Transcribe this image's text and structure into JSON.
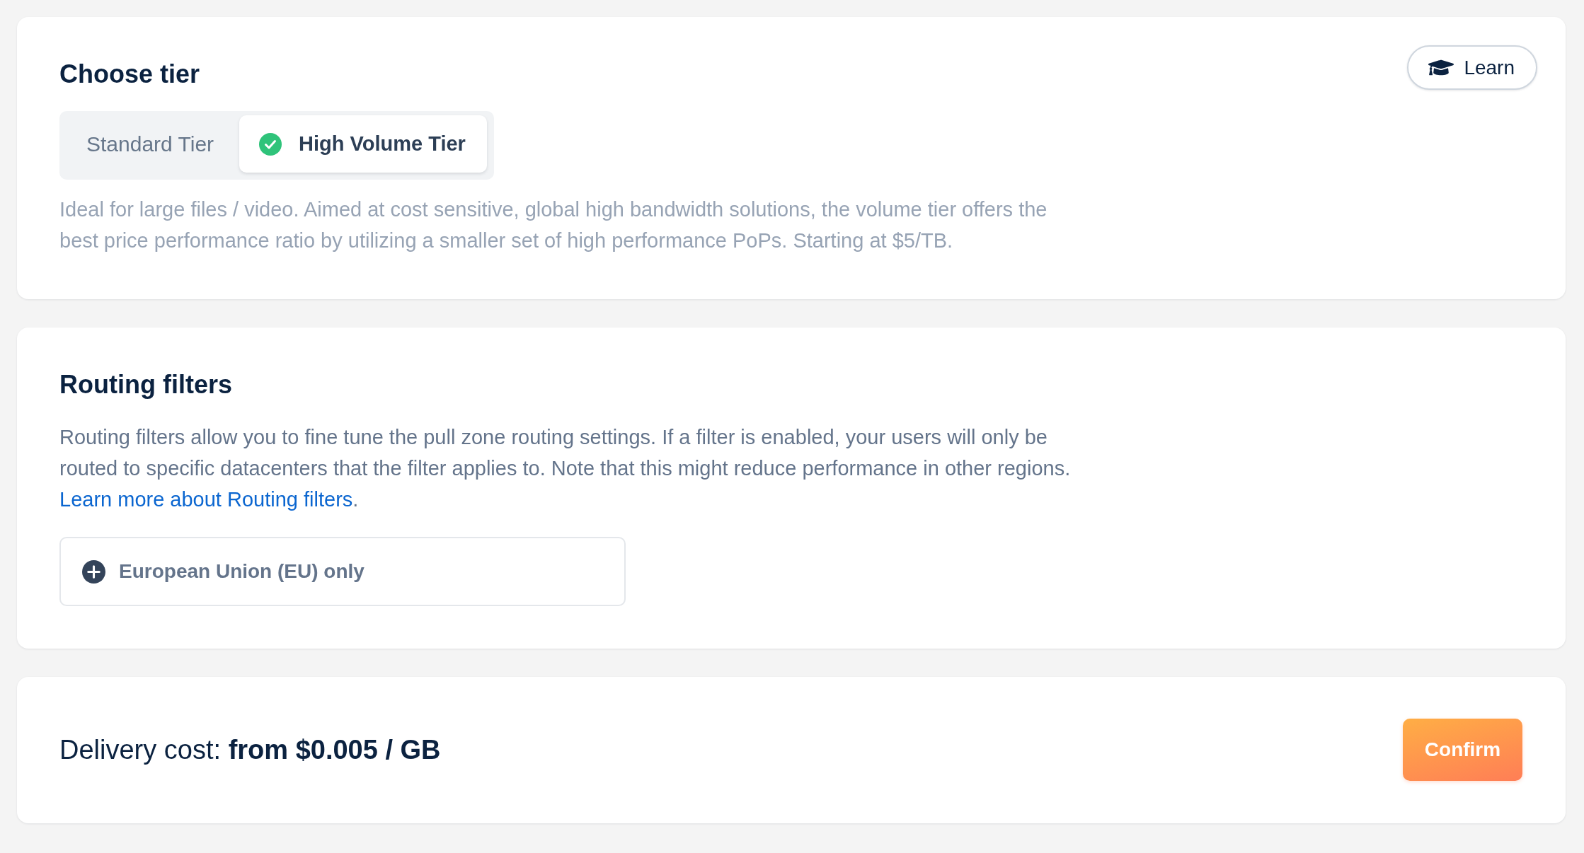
{
  "tier_section": {
    "title": "Choose tier",
    "learn_button": "Learn",
    "tiers": [
      {
        "label": "Standard Tier",
        "selected": false
      },
      {
        "label": "High Volume Tier",
        "selected": true
      }
    ],
    "description": "Ideal for large files / video. Aimed at cost sensitive, global high bandwidth solutions, the volume tier offers the best price performance ratio by utilizing a smaller set of high performance PoPs. Starting at $5/TB."
  },
  "routing_section": {
    "title": "Routing filters",
    "description": "Routing filters allow you to fine tune the pull zone routing settings. If a filter is enabled, your users will only be routed to specific datacenters that the filter applies to. Note that this might reduce performance in other regions.",
    "link": "Learn more about Routing filters",
    "link_end": ".",
    "filters": [
      {
        "label": "European Union (EU) only",
        "enabled": false
      }
    ]
  },
  "delivery_section": {
    "cost": "Delivery cost: **from $0.005 / GB**",
    "confirm_button": "Confirm"
  }
}
